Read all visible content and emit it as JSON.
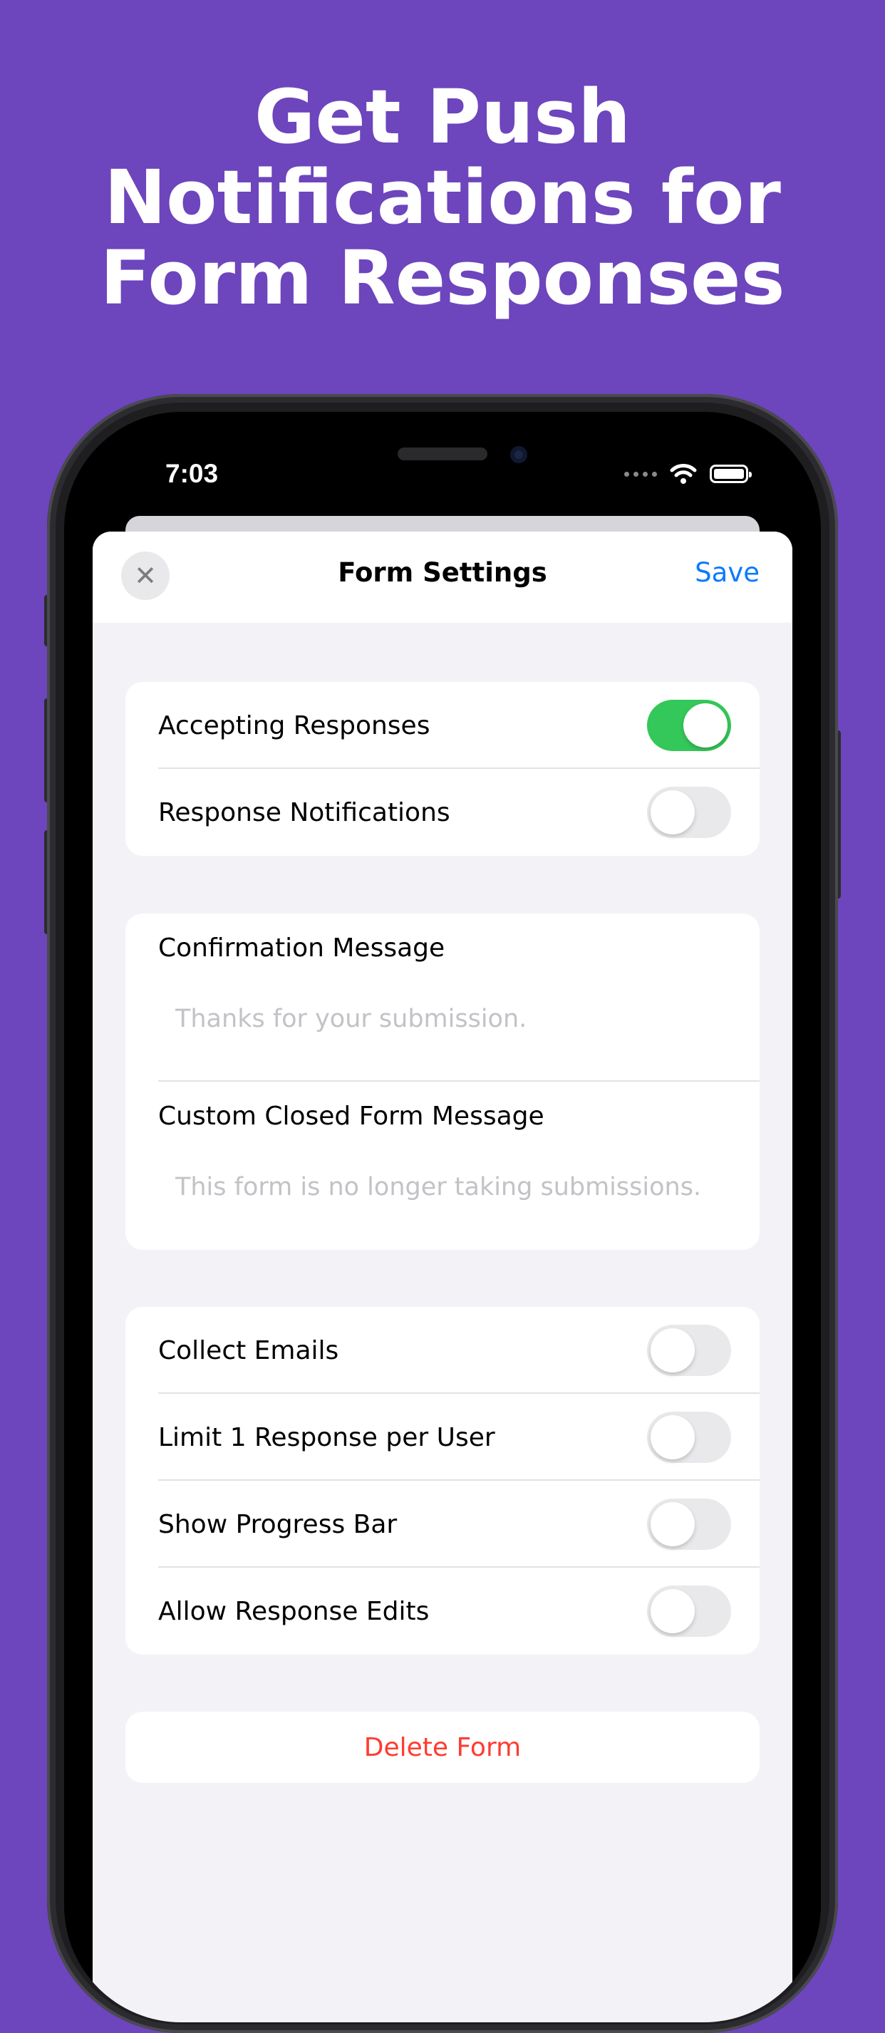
{
  "promo": {
    "headline_lines": [
      "Get Push",
      "Notifications for",
      "Form Responses"
    ],
    "background_color": "#6D45BC"
  },
  "status_bar": {
    "time": "7:03",
    "icons": [
      "cellular-dots-icon",
      "wifi-icon",
      "battery-icon"
    ]
  },
  "navbar": {
    "close_icon": "close-icon",
    "close_glyph": "✕",
    "title": "Form Settings",
    "save_label": "Save"
  },
  "response_settings": [
    {
      "label": "Accepting Responses",
      "on": true
    },
    {
      "label": "Response Notifications",
      "on": false
    }
  ],
  "messages": [
    {
      "title": "Confirmation Message",
      "placeholder": "Thanks for your submission.",
      "value": ""
    },
    {
      "title": "Custom Closed Form Message",
      "placeholder": "This form is no longer taking submissions.",
      "value": ""
    }
  ],
  "options": [
    {
      "label": "Collect Emails",
      "on": false
    },
    {
      "label": "Limit 1 Response per User",
      "on": false
    },
    {
      "label": "Show Progress Bar",
      "on": false
    },
    {
      "label": "Allow Response Edits",
      "on": false
    }
  ],
  "delete_label": "Delete Form",
  "colors": {
    "accent_blue": "#0A7AFF",
    "toggle_on": "#34C759",
    "destructive": "#FF3B30"
  }
}
